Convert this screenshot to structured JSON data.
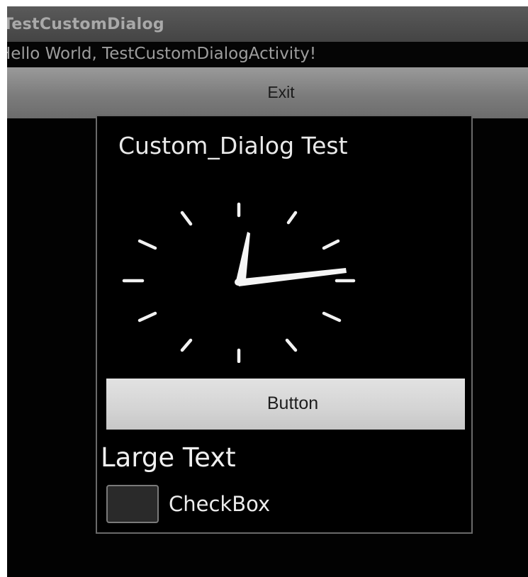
{
  "app": {
    "title": "TestCustomDialog"
  },
  "main": {
    "hello_text": "Hello World, TestCustomDialogActivity!",
    "exit_label": "Exit"
  },
  "dialog": {
    "title": "Custom_Dialog Test",
    "clock_icon": "analog-clock",
    "button_label": "Button",
    "large_text": "Large Text",
    "checkbox": {
      "label": "CheckBox",
      "checked": false
    }
  },
  "colors": {
    "screen_background": "#020202",
    "title_bar": "#4e4e4e",
    "exit_button": "#868686",
    "dialog_button": "#d9d9d9",
    "dialog_border": "#6a6a6a",
    "text_light": "#ececec"
  }
}
